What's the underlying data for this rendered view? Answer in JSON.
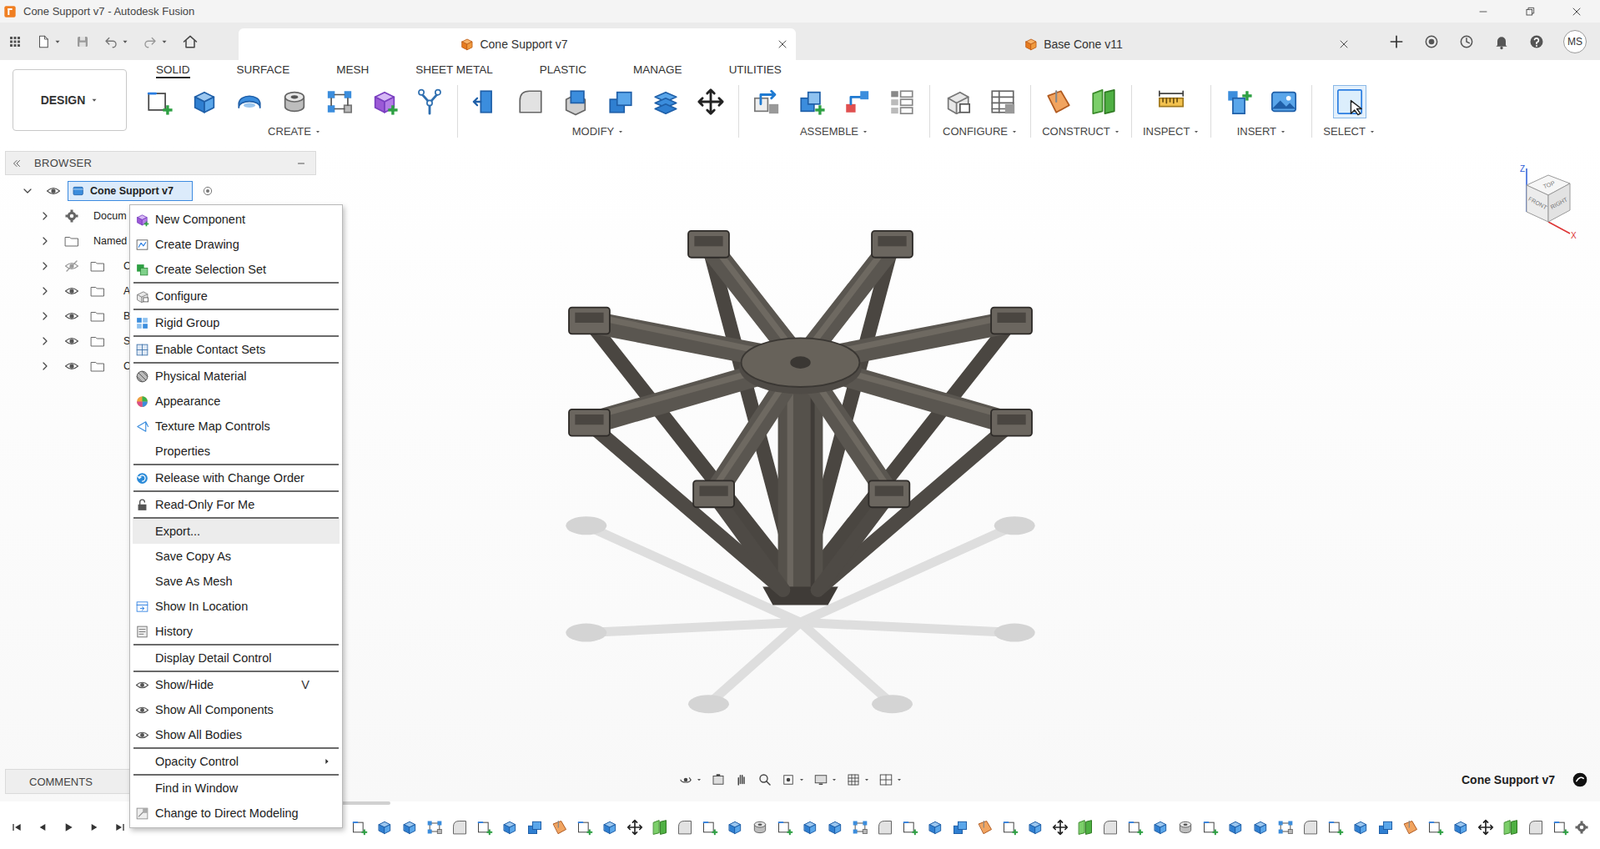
{
  "window": {
    "title": "Cone Support v7 - Autodesk Fusion"
  },
  "document_tabs": [
    {
      "label": "Cone Support v7",
      "selected": true
    },
    {
      "label": "Base Cone v11",
      "selected": false
    }
  ],
  "user": {
    "initials": "MS"
  },
  "workspace": {
    "label": "DESIGN"
  },
  "toolbar_tabs": [
    {
      "label": "SOLID",
      "selected": true
    },
    {
      "label": "SURFACE",
      "selected": false
    },
    {
      "label": "MESH",
      "selected": false
    },
    {
      "label": "SHEET METAL",
      "selected": false
    },
    {
      "label": "PLASTIC",
      "selected": false
    },
    {
      "label": "MANAGE",
      "selected": false
    },
    {
      "label": "UTILITIES",
      "selected": false
    }
  ],
  "toolbar_groups": [
    {
      "label": "CREATE",
      "tool_count": 7,
      "selected": false
    },
    {
      "label": "MODIFY",
      "tool_count": 6,
      "selected": false
    },
    {
      "label": "ASSEMBLE",
      "tool_count": 4,
      "selected": false
    },
    {
      "label": "CONFIGURE",
      "tool_count": 2,
      "selected": false
    },
    {
      "label": "CONSTRUCT",
      "tool_count": 2,
      "selected": false
    },
    {
      "label": "INSPECT",
      "tool_count": 1,
      "selected": false
    },
    {
      "label": "INSERT",
      "tool_count": 2,
      "selected": false
    },
    {
      "label": "SELECT",
      "tool_count": 1,
      "selected": true
    }
  ],
  "browser": {
    "title": "BROWSER",
    "items": [
      {
        "label": "Cone Support v7",
        "kind": "component",
        "depth": 0,
        "expanded": true,
        "visible": true,
        "selected": true
      },
      {
        "label": "Docum",
        "kind": "settings",
        "depth": 1,
        "expanded": false,
        "visible": true,
        "selected": false
      },
      {
        "label": "Named",
        "kind": "views",
        "depth": 1,
        "expanded": false,
        "visible": true,
        "selected": false
      },
      {
        "label": "C",
        "kind": "folder",
        "depth": 1,
        "expanded": false,
        "visible": false,
        "selected": false
      },
      {
        "label": "A",
        "kind": "folder",
        "depth": 1,
        "expanded": false,
        "visible": true,
        "selected": false
      },
      {
        "label": "B",
        "kind": "folder",
        "depth": 1,
        "expanded": false,
        "visible": true,
        "selected": false
      },
      {
        "label": "S",
        "kind": "folder",
        "depth": 1,
        "expanded": false,
        "visible": true,
        "selected": false
      },
      {
        "label": "C",
        "kind": "folder",
        "depth": 1,
        "expanded": false,
        "visible": true,
        "selected": false
      }
    ]
  },
  "comments": {
    "title": "COMMENTS"
  },
  "context_menu": {
    "sections": [
      [
        {
          "label": "New Component",
          "selected": false,
          "submenu": false
        },
        {
          "label": "Create Drawing",
          "selected": false,
          "submenu": false
        },
        {
          "label": "Create Selection Set",
          "selected": false,
          "submenu": false
        }
      ],
      [
        {
          "label": "Configure",
          "selected": false,
          "submenu": false
        }
      ],
      [
        {
          "label": "Rigid Group",
          "selected": false,
          "submenu": false
        }
      ],
      [
        {
          "label": "Enable Contact Sets",
          "selected": false,
          "submenu": false
        }
      ],
      [
        {
          "label": "Physical Material",
          "selected": false,
          "submenu": false
        },
        {
          "label": "Appearance",
          "selected": false,
          "submenu": false
        },
        {
          "label": "Texture Map Controls",
          "selected": false,
          "submenu": false
        },
        {
          "label": "Properties",
          "selected": false,
          "submenu": false
        }
      ],
      [
        {
          "label": "Release with Change Order",
          "selected": false,
          "submenu": false
        }
      ],
      [
        {
          "label": "Read-Only For Me",
          "selected": false,
          "submenu": false
        }
      ],
      [
        {
          "label": "Export...",
          "selected": true,
          "submenu": false
        },
        {
          "label": "Save Copy As",
          "selected": false,
          "submenu": false
        },
        {
          "label": "Save As Mesh",
          "selected": false,
          "submenu": false
        },
        {
          "label": "Show In Location",
          "selected": false,
          "submenu": false
        },
        {
          "label": "History",
          "selected": false,
          "submenu": false
        }
      ],
      [
        {
          "label": "Display Detail Control",
          "selected": false,
          "submenu": false
        }
      ],
      [
        {
          "label": "Show/Hide",
          "shortcut": "V",
          "selected": false,
          "submenu": false
        },
        {
          "label": "Show All Components",
          "selected": false,
          "submenu": false
        },
        {
          "label": "Show All Bodies",
          "selected": false,
          "submenu": false
        }
      ],
      [
        {
          "label": "Opacity Control",
          "selected": false,
          "submenu": true
        }
      ],
      [
        {
          "label": "Find in Window",
          "selected": false,
          "submenu": false
        },
        {
          "label": "Change to Direct Modeling",
          "selected": false,
          "submenu": false
        }
      ]
    ]
  },
  "view_cube": {
    "top": "TOP",
    "front": "FRONT",
    "right": "RIGHT",
    "axis_z": "Z",
    "axis_x": "X"
  },
  "status": {
    "active_component": "Cone Support v7"
  },
  "timeline": {
    "feature_count": 49
  }
}
